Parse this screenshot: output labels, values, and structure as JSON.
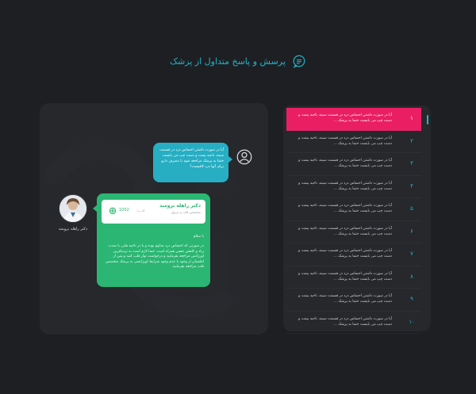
{
  "page": {
    "title": "پرسش و پاسخ متداول از پزشک"
  },
  "chat": {
    "question": "آیا در صورت داشتن احساس درد در قسمت سینه، ناحیه پشت و دست چپ می بایست حتما به پزشک مراجعه شود یا مصرف دارو برای آنها درد کافیست؟",
    "doctor_caption": "دکتر راهله برومند",
    "doctor_name": "دکتر راهله برومند",
    "doctor_specialty": "متخصص قلب و عروق",
    "doctor_code_label": "کد پ:",
    "doctor_code": "1002",
    "greeting": "با سلام",
    "answer": "در صورتی که احساس درد مداوم بوده و یا در ناحیه هایی با شدت زیاد و کاهش تنفس همراه است، حتما لازم است به نزدیکترین اورژانس مراجعه بفرمایید و درخواست نوار قلب کنید و پس از اطمینان از وجود یا عدم وجود شرایط اورژانسی به پزشک متخصص قلب مراجعه بفرمایید."
  },
  "faq": {
    "items": [
      {
        "num": "۱",
        "q": "آیا در صورت داشتن احساس درد در قسمت سینه، ناحیه پشت و دست چپ می بایست حتما به پزشک ...",
        "active": true
      },
      {
        "num": "۲",
        "q": "آیا در صورت داشتن احساس درد در قسمت سینه، ناحیه پشت و دست چپ می بایست حتما به پزشک ...",
        "active": false
      },
      {
        "num": "۳",
        "q": "آیا در صورت داشتن احساس درد در قسمت سینه، ناحیه پشت و دست چپ می بایست حتما به پزشک ...",
        "active": false
      },
      {
        "num": "۴",
        "q": "آیا در صورت داشتن احساس درد در قسمت سینه، ناحیه پشت و دست چپ می بایست حتما به پزشک ...",
        "active": false
      },
      {
        "num": "۵",
        "q": "آیا در صورت داشتن احساس درد در قسمت سینه، ناحیه پشت و دست چپ می بایست حتما به پزشک ...",
        "active": false
      },
      {
        "num": "۶",
        "q": "آیا در صورت داشتن احساس درد در قسمت سینه، ناحیه پشت و دست چپ می بایست حتما به پزشک ...",
        "active": false
      },
      {
        "num": "۷",
        "q": "آیا در صورت داشتن احساس درد در قسمت سینه، ناحیه پشت و دست چپ می بایست حتما به پزشک ...",
        "active": false
      },
      {
        "num": "۸",
        "q": "آیا در صورت داشتن احساس درد در قسمت سینه، ناحیه پشت و دست چپ می بایست حتما به پزشک ...",
        "active": false
      },
      {
        "num": "۹",
        "q": "آیا در صورت داشتن احساس درد در قسمت سینه، ناحیه پشت و دست چپ می بایست حتما به پزشک ...",
        "active": false
      },
      {
        "num": "۱۰",
        "q": "آیا در صورت داشتن احساس درد در قسمت سینه، ناحیه پشت و دست چپ می بایست حتما به پزشک ...",
        "active": false
      }
    ]
  },
  "colors": {
    "background": "#1e1f23",
    "panel": "#26282c",
    "accent_teal": "#27aec2",
    "accent_green": "#2bb673",
    "active_pink": "#e91e63"
  },
  "icons": {
    "title": "chat-bubble-icon",
    "user": "user-icon",
    "doctor_logo": "clinic-logo-icon"
  }
}
